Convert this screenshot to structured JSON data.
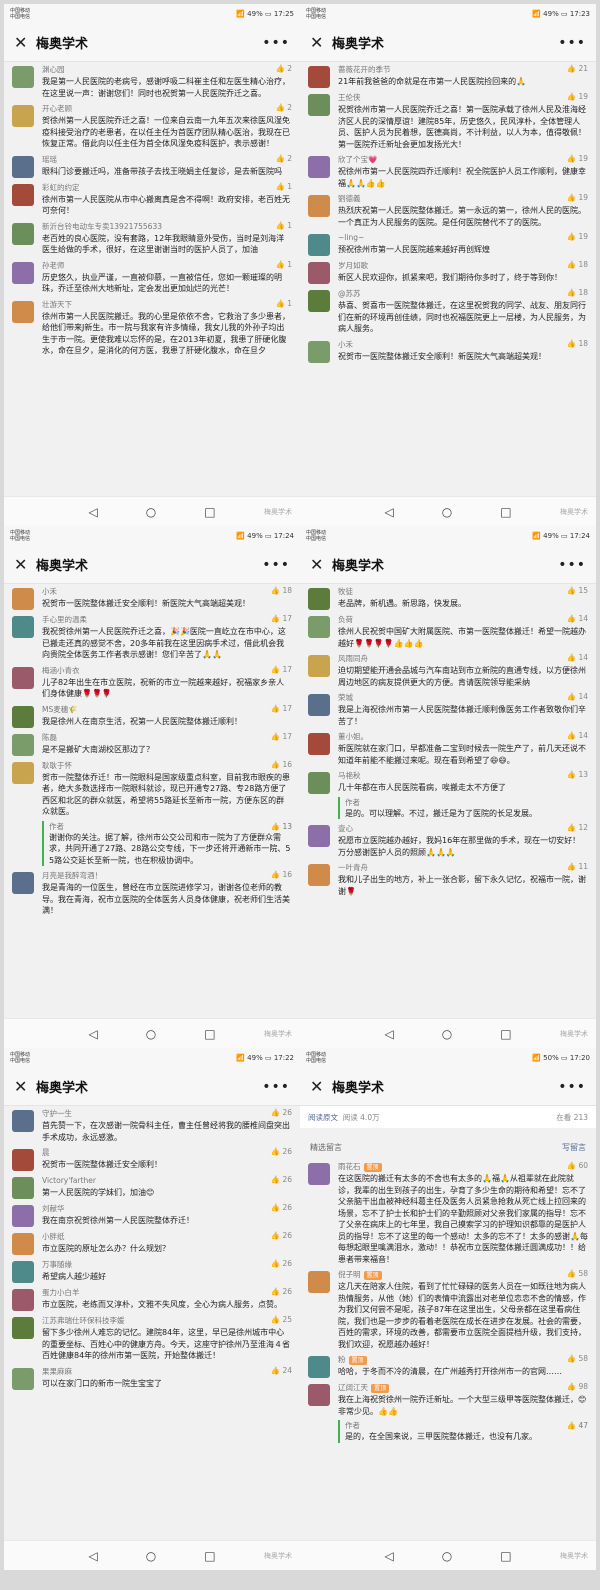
{
  "app_title": "梅奥学术",
  "watermark": "梅奥学术",
  "panels": [
    {
      "time": "17:25",
      "battery": "49%",
      "comments": [
        {
          "name": "渊心园",
          "likes": "2",
          "text": "我是第一人民医院的老病号，感谢呼吸二科崔主任和左医生精心治疗，在这里说一声：谢谢您们！同时也祝贺第一人民医院乔迁之喜。"
        },
        {
          "name": "开心老顾",
          "likes": "2",
          "text": "贺徐州第一人民医院乔迁之喜！一位来自云南一九年五次来徐医风湿免疫科接受治疗的老患者，在以任主任为首医疗团队精心医治，我现在已恢复正常。借此向以任主任为首全体风湿免疫科医护，表示感谢！"
        },
        {
          "name": "瑶瑶",
          "likes": "2",
          "text": "眼科门诊要搬迁吗，准备带孩子去找王晓娟主任复诊，是去新医院吗"
        },
        {
          "name": "彩虹的约定",
          "likes": "1",
          "text": "徐州市第一人民医院从市中心搬离真是舍不得啊！政府安排，老百姓无可奈何！"
        },
        {
          "name": "新沂台铃电动车专卖13921755633",
          "likes": "1",
          "text": "老百姓的良心医院，没有套路，12年我眼睛意外受伤，当时是刘海洋医生给做的手术，很好，在这里谢谢当时的医护人员了，加油"
        },
        {
          "name": "孙老师",
          "likes": "1",
          "text": "历史悠久，执业严谨，一直被仰慕，一直被信任，您如一颗璀璨的明珠，乔迁至徐州大地新址，定会发出更加灿烂的光芒！"
        },
        {
          "name": "壮游天下",
          "likes": "1",
          "text": "徐州市第一人民医院搬迁。我的心里是依依不舍，它救治了多少患者，给他们带来J新生。市一院与我家有许多情缘，我女儿我的外孙子均出生于市一院。更使我难以忘怀的是，在2013年初夏，我患了肝硬化腹水，命在旦夕，是消化的何方医，我患了肝硬化腹水，命在旦夕"
        }
      ]
    },
    {
      "time": "17:23",
      "battery": "49%",
      "comments": [
        {
          "name": "蔷薇花开的季节",
          "likes": "21",
          "text": "21年前我爸爸的命就是在市第一人民医院捡回来的🙏"
        },
        {
          "name": "王伦侠",
          "likes": "19",
          "text": "祝贺徐州市第一人民医院乔迁之喜！第一医院承载了徐州人民及淮海经济区人民的深情厚谊！建院85年，历史悠久，民风淳朴，全体管理人员、医护人员为民着想，医德高尚，不计利益，以人为本，值得敬佩！第一医院乔迁新址会更加发扬光大！"
        },
        {
          "name": "欣了个宝💗",
          "likes": "19",
          "text": "祝徐州市第一人民医院四乔迁顺利！祝全院医护人员工作顺利，健康幸福🙏🙏👍👍"
        },
        {
          "name": "劉德義",
          "likes": "19",
          "text": "热烈庆祝第一人民医院整体搬迁。第一永远的第一，徐州人民的医院。一个真正为人民服务的医院。是任何医院替代不了的医院。"
        },
        {
          "name": "~ling~",
          "likes": "19",
          "text": "预祝徐州市第一人民医院越来越好再创辉煌"
        },
        {
          "name": "岁月如歌",
          "likes": "18",
          "text": "新区人民欢迎你，抓紧来吧，我们期待你多时了，终于等到你！"
        },
        {
          "name": "@苏苏",
          "likes": "18",
          "text": "恭喜、贺喜市一医院整体搬迁，在这里祝贺我的同学、战友、朋友同行们在新的环境再创佳绩，同时也祝福医院更上一层楼，为人民服务，为病人服务。"
        },
        {
          "name": "小禾",
          "likes": "18",
          "text": "祝贺市一医院整体搬迁安全顺利！新医院大气高端超美观！"
        }
      ]
    },
    {
      "time": "17:24",
      "battery": "49%",
      "comments": [
        {
          "name": "小禾",
          "likes": "18",
          "text": "祝贺市一医院整体搬迁安全顺利！新医院大气高端超美观！"
        },
        {
          "name": "手心里的温柔",
          "likes": "17",
          "text": "我祝贺徐州第一人民医院乔迁之喜，🎉🎉医院一直屹立在市中心，这已搬走还真的感觉不舍，20多年前我在这里因病手术过，借此机会我向贵院全体医务工作者表示感谢！您们辛苦了🙏🙏"
        },
        {
          "name": "梅涵小青衣",
          "likes": "17",
          "text": "儿子82年出生在市立医院，祝新的市立一院越来越好，祝福家乡亲人们身体健康🌹🌹🌹"
        },
        {
          "name": "MS麦穗🌾",
          "likes": "17",
          "text": "我是徐州人在南京生活，祝第一人民医院整体搬迁顺利！"
        },
        {
          "name": "陈磊",
          "likes": "17",
          "text": "是不是搬矿大南湖校区那边了？"
        },
        {
          "name": "耿耿于怀",
          "likes": "16",
          "text": "贺市一院整体乔迁！市一院眼科是国家级重点科室，目前我市眼疾的患者，绝大多数选择市一院眼科就诊，现已开通专27路、专28路方便了西区和北区的群众就医，希望将55路延长至新市一院，方便东区的群众就医。",
          "reply": {
            "author": "作者",
            "likes": "13",
            "text": "谢谢你的关注。据了解，徐州市公交公司和市一院为了方便群众需求，共同开通了27路、28路公交专线，下一步还将开通新市一院、55路公交延长至新一院，也在积极协调中。"
          }
        },
        {
          "name": "月亮是我醉弯酒！",
          "likes": "16",
          "text": "我是青海的一位医生，曾经在市立医院进修学习，谢谢各位老师的教导。我在青海，祝市立医院的全体医务人员身体健康，祝老师们生活美满！"
        }
      ]
    },
    {
      "time": "17:24",
      "battery": "49%",
      "comments": [
        {
          "name": "牧徒",
          "likes": "15",
          "text": "老品牌，新机遇。新思路，快发展。"
        },
        {
          "name": "负荷",
          "likes": "14",
          "text": "徐州人民祝贺中国矿大附属医院、市第一医院整体搬迁！希望一院越办越好🌹🌹🌹🌹👍👍👍"
        },
        {
          "name": "风雨同舟",
          "likes": "14",
          "text": "迫切期望能开通会品城与汽车南站到市立新院的直通专线，以方便徐州周边地区的病友提供更大的方便。肯请医院领导能采纳"
        },
        {
          "name": "荣城",
          "likes": "14",
          "text": "我是上海祝徐州市第一人民医院整体搬迁顺利像医务工作者致敬你们辛苦了！"
        },
        {
          "name": "董小姐。",
          "likes": "14",
          "text": "新医院就在家门口，早都准备二宝到时候去一院生产了，前几天还说不知道年前能不能搬过来呢。现在看到希望了😄😄。"
        },
        {
          "name": "马艳秋",
          "likes": "13",
          "text": "几十年都在市人民医院看病，唉搬走太不方便了",
          "reply": {
            "author": "作者",
            "likes": "",
            "text": "是的。可以理解。不过，搬迁是为了医院的长足发展。"
          }
        },
        {
          "name": "壹心",
          "likes": "12",
          "text": "祝愿市立医院越办越好，我妈16年在那里做的手术，现在一切安好！万分感谢医护人员的照顾🙏🙏🙏"
        },
        {
          "name": "一叶青舟",
          "likes": "11",
          "text": "我和儿子出生的地方，补上一张合影，留下永久记忆，祝福市一院，谢谢🌹"
        }
      ]
    },
    {
      "time": "17:22",
      "battery": "49%",
      "comments": [
        {
          "name": "守护一生",
          "likes": "26",
          "text": "首先赞一下，在次感谢一院骨科主任，曹主任曾经将我的腰椎间盘突出手术成功，永远感激。"
        },
        {
          "name": "晨",
          "likes": "26",
          "text": "祝贺市一医院整体搬迁安全顺利！"
        },
        {
          "name": "Victory'farther",
          "likes": "26",
          "text": "第一人民医院的学妹们，加油😊"
        },
        {
          "name": "刘献华",
          "likes": "26",
          "text": "我在南京祝贺徐州第一人民医院整体乔迁！"
        },
        {
          "name": "小胖纸",
          "likes": "26",
          "text": "市立医院的原址怎么办？什么规划？"
        },
        {
          "name": "万事随缘",
          "likes": "26",
          "text": "希望病人越少越好"
        },
        {
          "name": "蛋力小白羊",
          "likes": "26",
          "text": "市立医院，老练而又淳朴，文雅不失风度，全心为病人服务，点赞。"
        },
        {
          "name": "江苏弗瑞仕环保科技李媛",
          "likes": "25",
          "text": "留下多少徐州人难忘的记忆。建院84年，这里，早已是徐州城市中心的重要坐标、百姓心中的健康方舟。今天，这座守护徐州乃至淮海４省百姓健康84年的徐州市第一医院，开始整体搬迁！"
        },
        {
          "name": "果果麻麻",
          "likes": "24",
          "text": "可以在家门口的新市一院生宝宝了"
        }
      ]
    },
    {
      "time": "17:20",
      "battery": "50%",
      "read_original": "阅读原文",
      "read_count": "阅读 4.0万",
      "watching": "在看 213",
      "featured_label": "精选留言",
      "write_label": "写留言",
      "comments": [
        {
          "name": "雨花石",
          "tag": "置顶",
          "likes": "60",
          "text": "在这医院的搬迁有太多的不舍也有太多的🙏福🙏从祖辈就在此院就诊，我辈的出生到孩子的出生，孕育了多少生命的期待和希望！忘不了父亲脑干出血被神经科葛主任及医务人员紧急抢救从死亡线上拉回来的场景，忘不了护士长和护士们的辛勤照顾对父亲我们家属的指导！忘不了父亲在病床上的七年里，我自己摸索学习的护理知识都靠的是医护人员的指导！忘不了这里的每一个感动！太多的忘不了！太多的感谢🙏每每想起眼里噙满泪水，激动！！恭祝市立医院整体搬迁圆满成功！！给患者带来福音！"
        },
        {
          "name": "倪子明",
          "tag": "置顶",
          "likes": "58",
          "text": "这几天在陪家人住院，看到了忙忙碌碌的医务人员在一如既往地为病人热情服务，从他（她）们的表情中流露出对老单位恋恋不舍的情感，作为我们又何尝不是呢，孩子87年在这里出生，父母亲都在这里看病住院，我们也是一步步的看着老医院在成长在进步在发展。社会的需要，百姓的需求，环境的改善，都需要市立医院全面提档升级，我们支持，我们欢迎，祝愿越办越好！"
        },
        {
          "name": "粉",
          "tag": "置顶",
          "likes": "58",
          "text": "哈哈，于冬而不冷的清晨，在广州越秀打开徐州市一的官网……"
        },
        {
          "name": "辽阔江天",
          "tag": "置顶",
          "likes": "98",
          "text": "我在上海祝贺徐州一院乔迁新址。一个大型三级甲等医院整体搬迁，😊非常少见。👍👍",
          "reply": {
            "author": "作者",
            "likes": "47",
            "text": "是的，在全国来说，三甲医院整体搬迁，也没有几家。"
          }
        }
      ]
    }
  ]
}
